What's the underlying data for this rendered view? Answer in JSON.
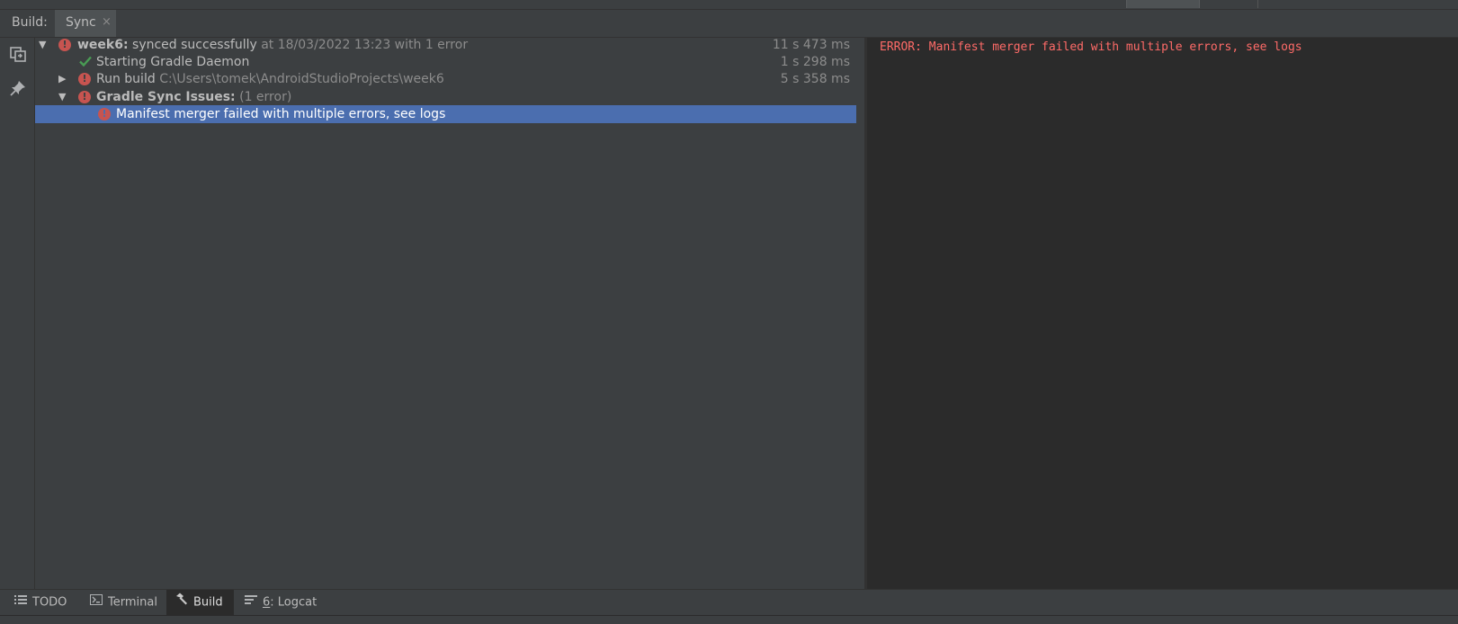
{
  "header": {
    "build_label": "Build:",
    "tab_label": "Sync",
    "tab_close": "×"
  },
  "tree": {
    "root": {
      "name": "week6:",
      "status": "synced successfully",
      "meta": "at 18/03/2022 13:23  with 1 error",
      "time": "11 s 473 ms"
    },
    "daemon": {
      "label": "Starting Gradle Daemon",
      "time": "1 s 298 ms"
    },
    "run_build": {
      "label": "Run build",
      "path": "C:\\Users\\tomek\\AndroidStudioProjects\\week6",
      "time": "5 s 358 ms"
    },
    "issues": {
      "label": "Gradle Sync Issues:",
      "count": "(1 error)"
    },
    "manifest": {
      "label": "Manifest merger failed with multiple errors, see logs"
    }
  },
  "console": {
    "line": "ERROR: Manifest merger failed with multiple errors, see logs"
  },
  "bottom_tabs": {
    "todo": "TODO",
    "terminal": "Terminal",
    "build": "Build",
    "logcat_num": "6",
    "logcat_label": ": Logcat"
  },
  "colors": {
    "error": "#c75450",
    "selection": "#4b6eaf",
    "success": "#499c54",
    "console_error": "#ff6b68"
  },
  "icons": [
    "restore-layout-icon",
    "pin-icon",
    "error-icon",
    "check-icon",
    "hammer-icon",
    "list-icon",
    "terminal-icon",
    "logcat-icon"
  ]
}
